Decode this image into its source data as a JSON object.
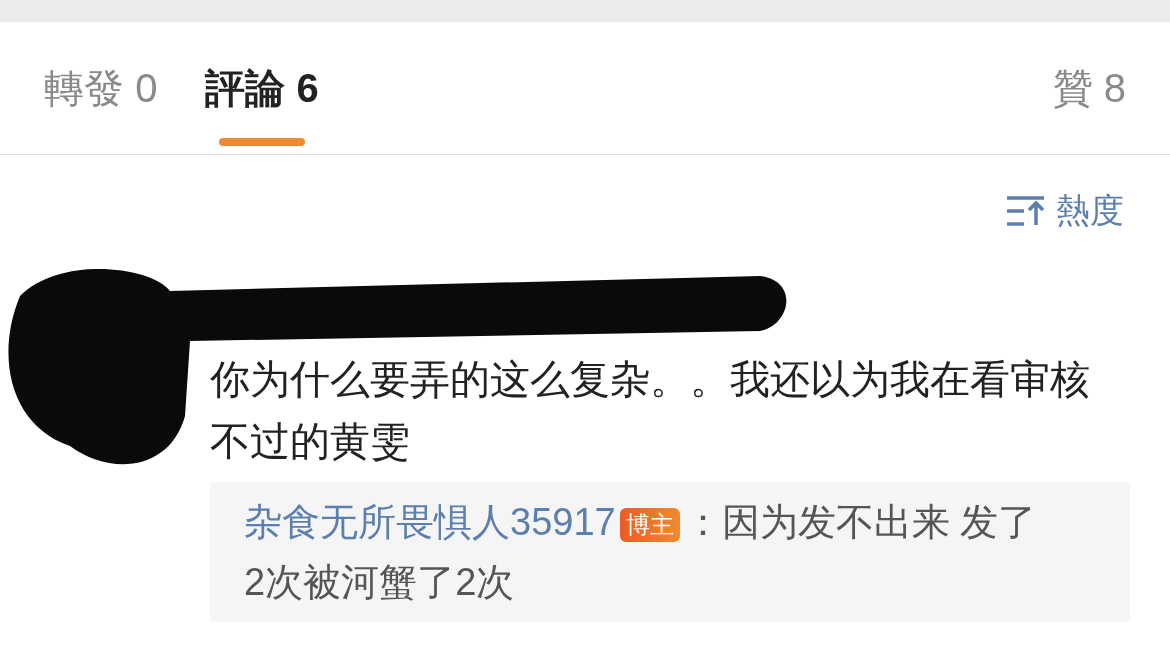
{
  "tabs": [
    {
      "label": "轉發",
      "count": "0",
      "selected": false
    },
    {
      "label": "評論",
      "count": "6",
      "selected": true
    },
    {
      "label": "贊",
      "count": "8",
      "selected": false
    }
  ],
  "sort": {
    "label": "熱度"
  },
  "comment": {
    "redacted": true,
    "text": "你为什么要弄的这么复杂。。我还以为我在看审核不过的黄雯",
    "reply": {
      "author": "杂食无所畏惧人35917",
      "badge": "博主",
      "text": "：因为发不出来 发了2次被河蟹了2次"
    }
  }
}
